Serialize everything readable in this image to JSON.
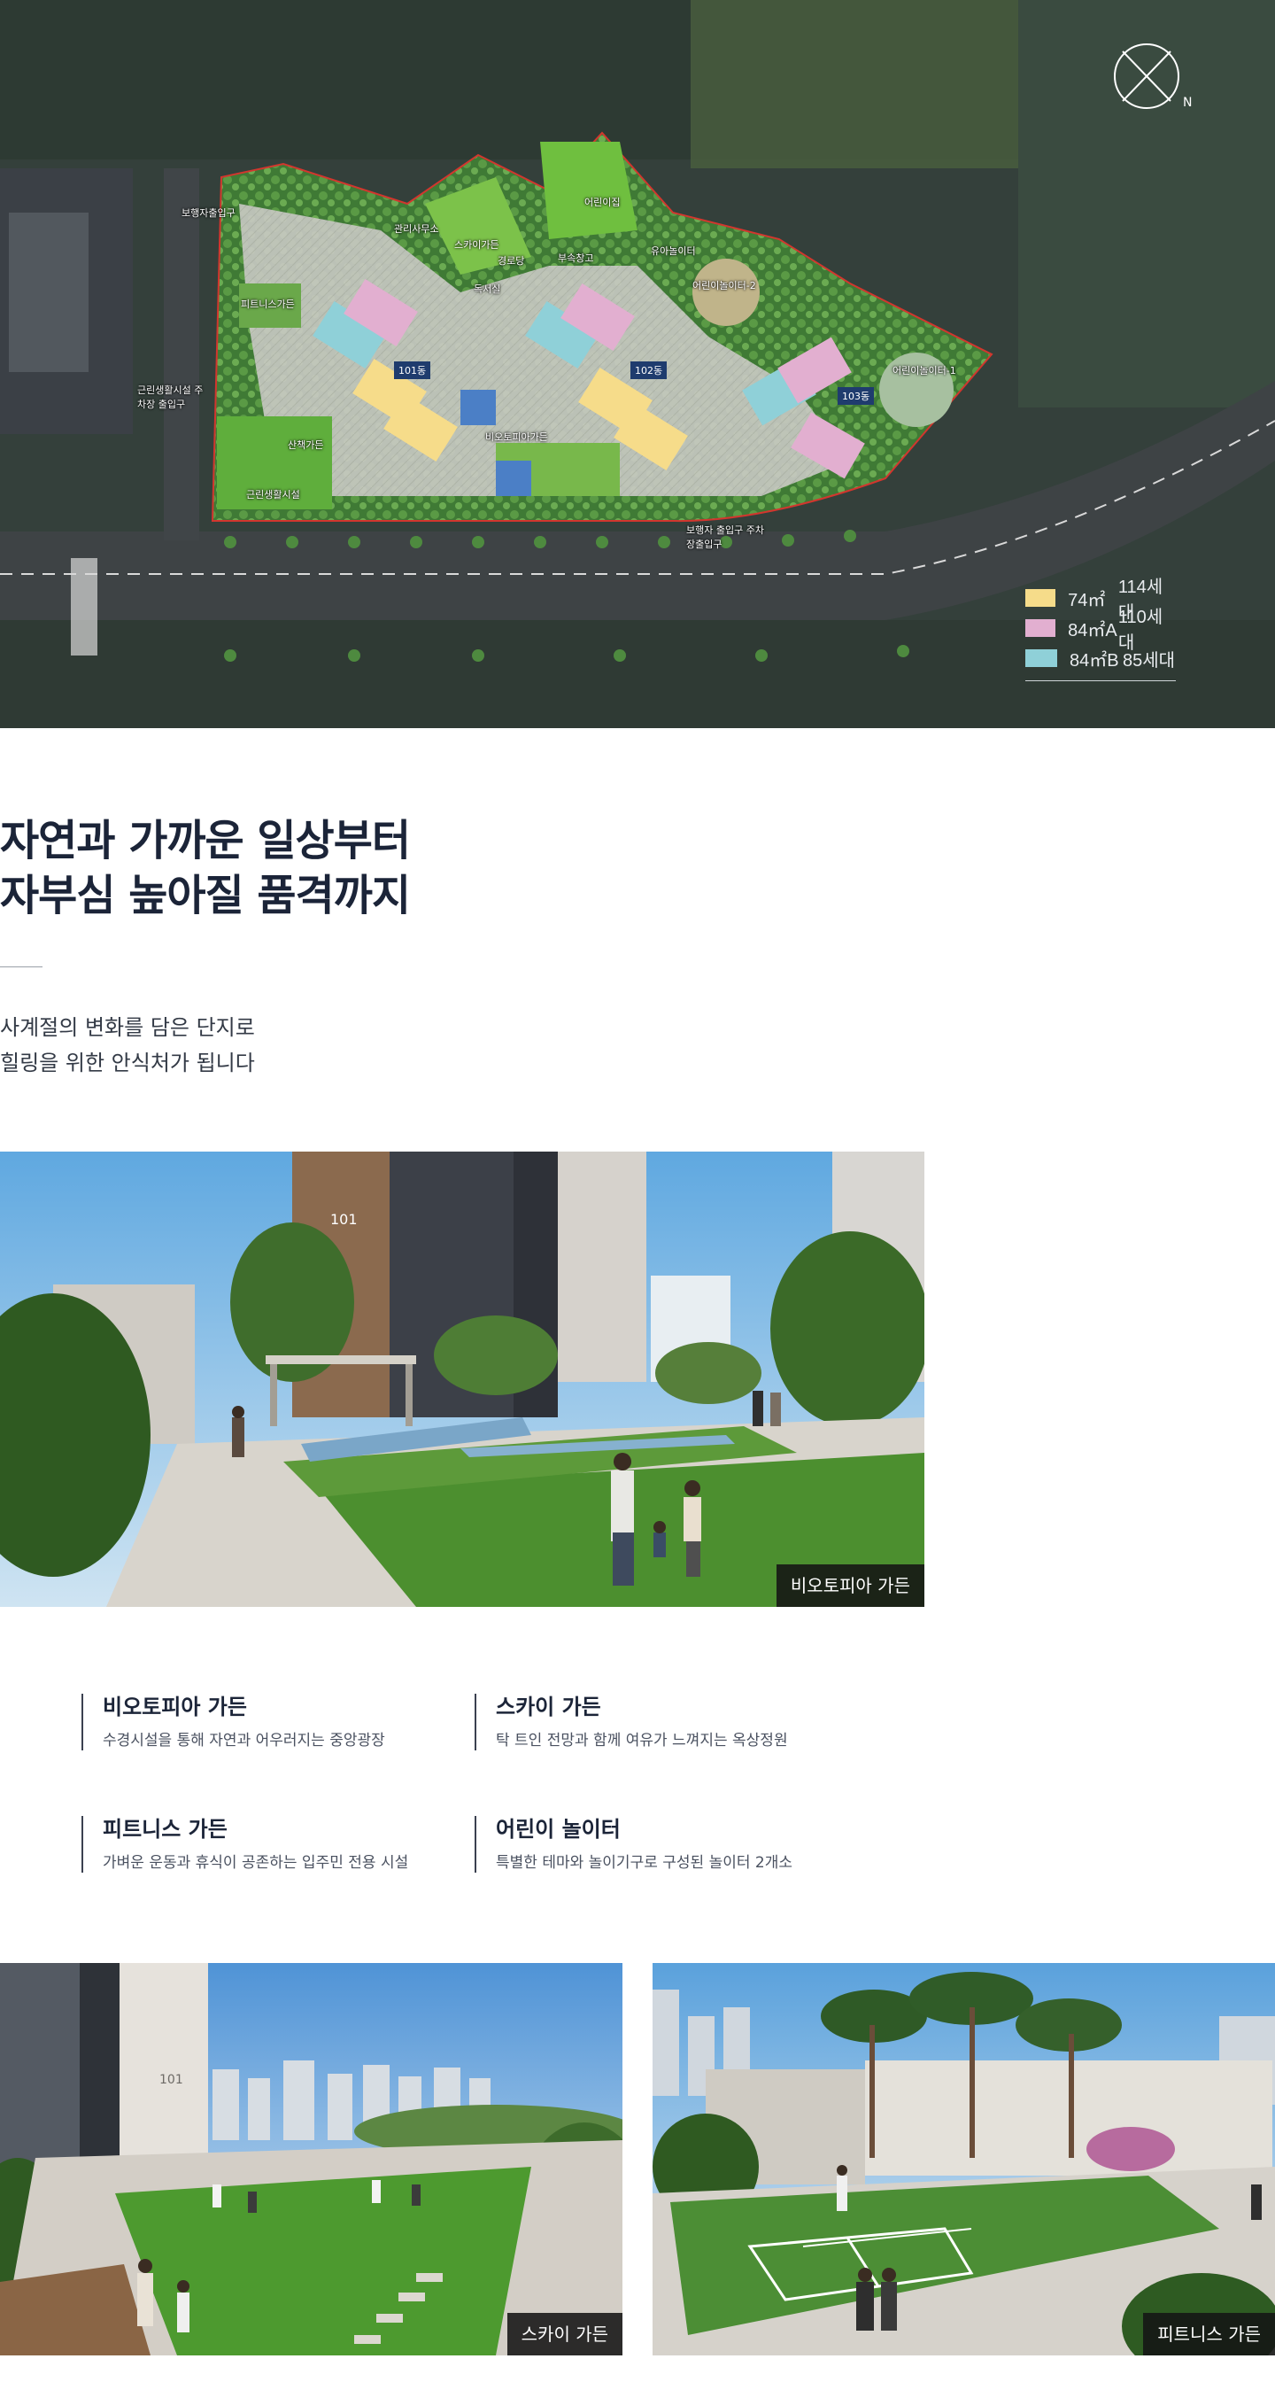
{
  "siteplan": {
    "legend": [
      {
        "type": "74㎡",
        "count": "114세대",
        "color": "#f6dc8a"
      },
      {
        "type": "84㎡A",
        "count": "110세대",
        "color": "#e2afd0"
      },
      {
        "type": "84㎡B",
        "count": "85세대",
        "color": "#8fd0d8"
      }
    ],
    "compass_letter": "N",
    "dongs": [
      "101동",
      "102동",
      "103동"
    ],
    "labels": {
      "fitness_garden": "피트니스가든",
      "management": "관리사무소",
      "sky_garden": "스카이가든",
      "senior": "경로당",
      "library": "독서실",
      "daycare": "어린이집",
      "store": "부속창고",
      "toddler_play": "유아놀이터",
      "kids_play_2": "어린이놀이터-2",
      "kids_play_1": "어린이놀이터-1",
      "biotopia": "비오토피아가든",
      "walk_garden": "산책가든",
      "neighborhood": "근린생활시설",
      "pedestrian_entrance": "보행자출입구",
      "parking_entrance_left": "근린생활시설 주차장 출입구",
      "parking_entrance_bottom": "보행자 출입구 주차장출입구"
    }
  },
  "intro": {
    "title_line1": "자연과 가까운 일상부터",
    "title_line2": "자부심 높아질 품격까지",
    "sub_line1": "사계절의 변화를 담은 단지로",
    "sub_line2": "힐링을 위한 안식처가 됩니다"
  },
  "photo_main": {
    "caption": "비오토피아 가든",
    "tower_no": "101"
  },
  "features": [
    {
      "title": "비오토피아 가든",
      "desc": "수경시설을 통해 자연과 어우러지는 중앙광장"
    },
    {
      "title": "스카이 가든",
      "desc": "탁 트인 전망과 함께 여유가 느껴지는 옥상정원"
    },
    {
      "title": "피트니스 가든",
      "desc": "가벼운 운동과 휴식이 공존하는 입주민 전용 시설"
    },
    {
      "title": "어린이 놀이터",
      "desc": "특별한 테마와 놀이기구로 구성된 놀이터 2개소"
    }
  ],
  "photo_sky": {
    "caption": "스카이 가든",
    "tower_no": "101"
  },
  "photo_fitness": {
    "caption": "피트니스 가든"
  }
}
